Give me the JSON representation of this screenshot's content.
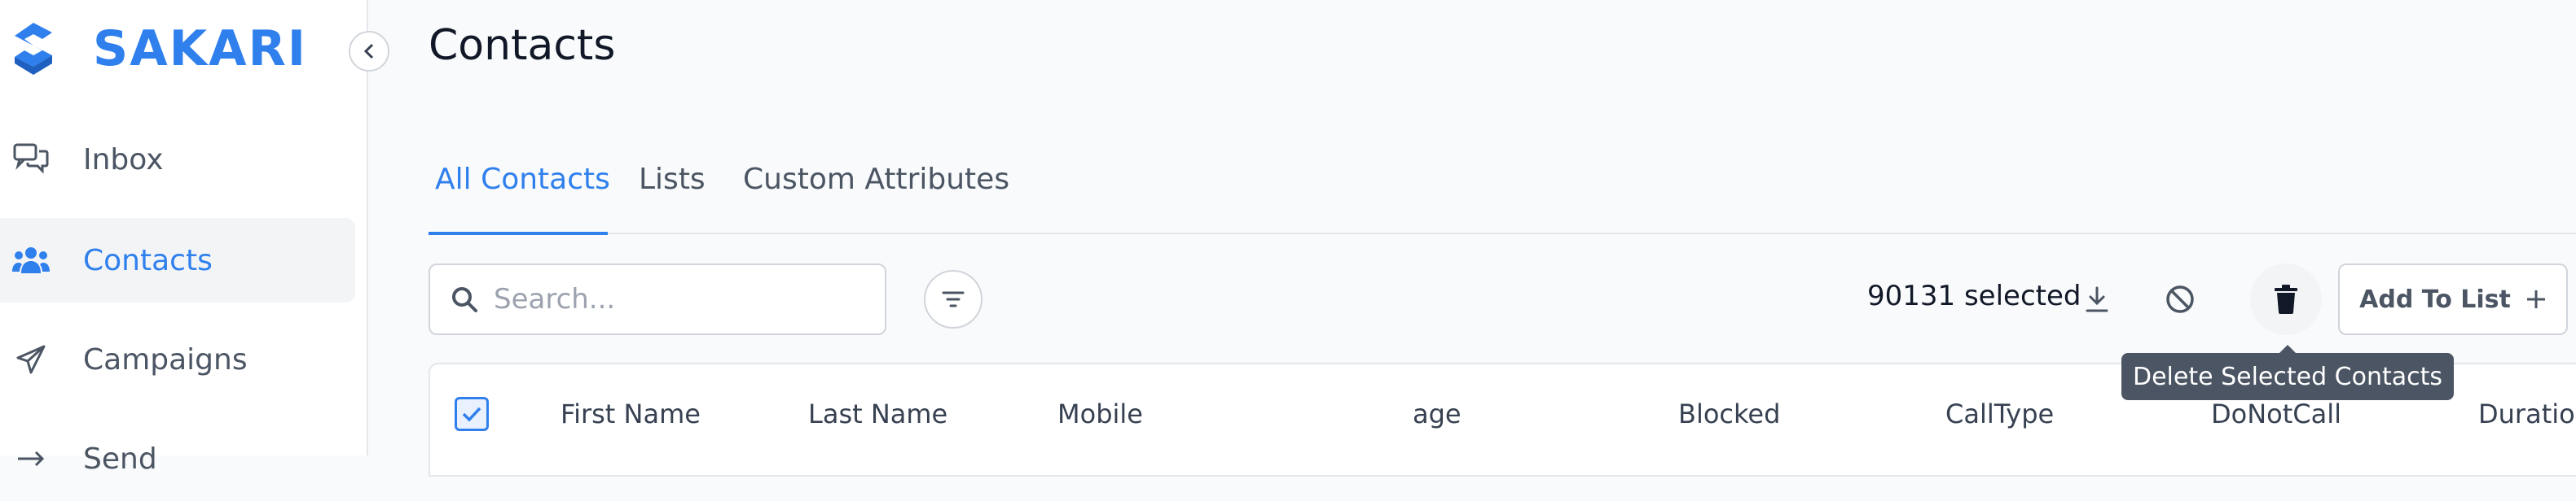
{
  "brand": {
    "name": "SAKARI",
    "color": "#2f80ed"
  },
  "sidebar": {
    "collapse_icon": "chevron-left-icon",
    "items": [
      {
        "label": "Inbox",
        "icon": "chat-bubbles-icon",
        "active": false
      },
      {
        "label": "Contacts",
        "icon": "users-icon",
        "active": true
      },
      {
        "label": "Campaigns",
        "icon": "send-icon",
        "active": false
      },
      {
        "label": "Send",
        "icon": "arrow-right-icon",
        "active": false
      }
    ]
  },
  "page": {
    "title": "Contacts"
  },
  "tabs": [
    {
      "label": "All Contacts",
      "active": true
    },
    {
      "label": "Lists",
      "active": false
    },
    {
      "label": "Custom Attributes",
      "active": false
    }
  ],
  "toolbar": {
    "search_placeholder": "Search...",
    "search_value": "",
    "selected_text": "90131 selected",
    "add_to_list_label": "Add To List",
    "tooltip": "Delete Selected Contacts"
  },
  "table": {
    "select_all_checked": true,
    "columns": [
      "First Name",
      "Last Name",
      "Mobile",
      "age",
      "Blocked",
      "CallType",
      "DoNotCall",
      "Duration"
    ]
  },
  "colors": {
    "accent": "#2f80ed",
    "tooltip_bg": "#4b5563",
    "border": "#d1d5db"
  }
}
